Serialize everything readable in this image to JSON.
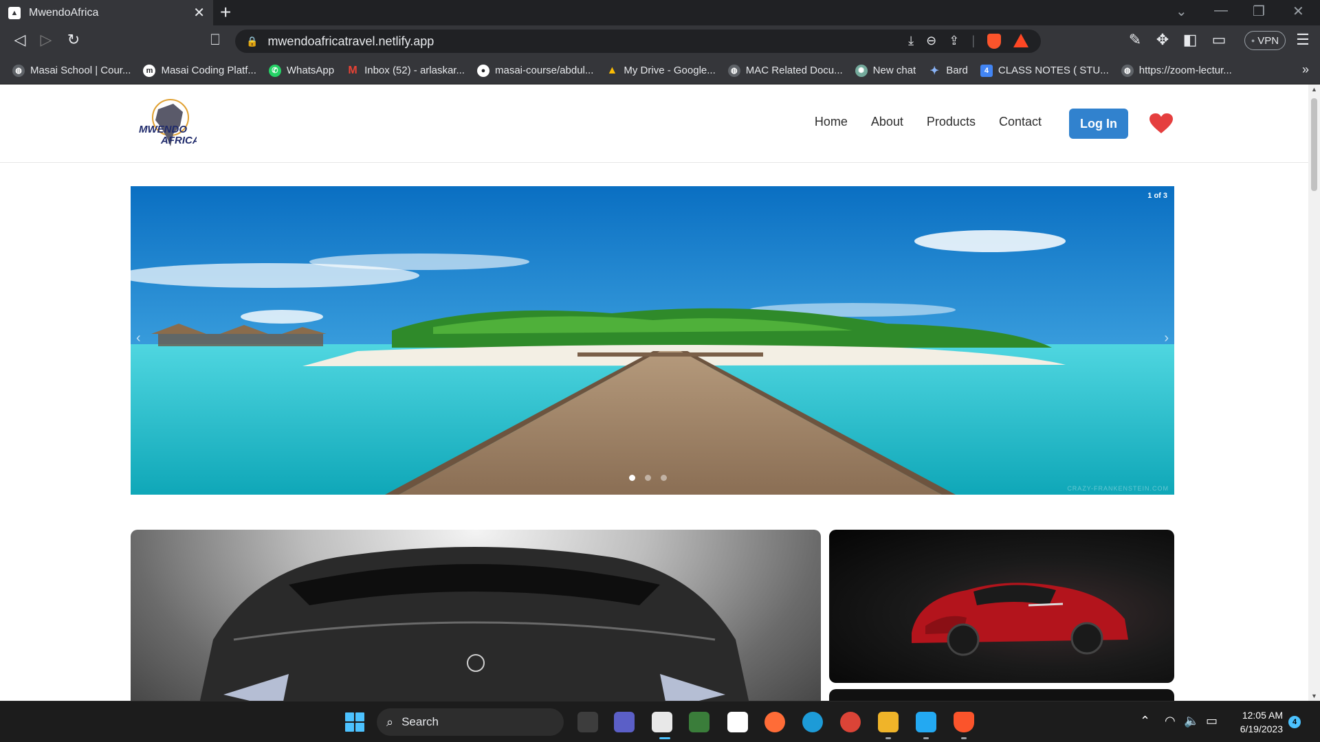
{
  "browser": {
    "tab": {
      "title": "MwendoAfrica",
      "favicon_icon": "page-icon"
    },
    "url": "mwendoafricatravel.netlify.app",
    "vpn_label": "VPN",
    "bookmarks": [
      {
        "label": "Masai School | Cour...",
        "icon": "globe-icon",
        "color": "#5f6368"
      },
      {
        "label": "Masai Coding Platf...",
        "icon": "m-icon",
        "color": "#202124"
      },
      {
        "label": "WhatsApp",
        "icon": "whatsapp-icon",
        "color": "#25d366"
      },
      {
        "label": "Inbox (52) - arlaskar...",
        "icon": "gmail-icon",
        "color": "#ea4335"
      },
      {
        "label": "masai-course/abdul...",
        "icon": "github-icon",
        "color": "#202124"
      },
      {
        "label": "My Drive - Google...",
        "icon": "drive-icon",
        "color": "#fbbc04"
      },
      {
        "label": "MAC Related Docu...",
        "icon": "globe-icon",
        "color": "#5f6368"
      },
      {
        "label": "New chat",
        "icon": "chatgpt-icon",
        "color": "#74aa9c"
      },
      {
        "label": "Bard",
        "icon": "bard-icon",
        "color": "#4285f4"
      },
      {
        "label": "CLASS NOTES ( STU...",
        "icon": "doc-4-icon",
        "color": "#4285f4"
      },
      {
        "label": "https://zoom-lectur...",
        "icon": "globe-icon",
        "color": "#5f6368"
      }
    ],
    "bookmark_4_badge": "4",
    "bookmarks_more": "»"
  },
  "site": {
    "logo_text_1": "MWENDO",
    "logo_text_2": "AFRICA",
    "nav": {
      "home": "Home",
      "about": "About",
      "products": "Products",
      "contact": "Contact"
    },
    "login_label": "Log In",
    "carousel": {
      "counter": "1 of 3",
      "active_index": 0,
      "slide_count": 3,
      "watermark": "CRAZY-FRANKENSTEIN.COM"
    }
  },
  "taskbar": {
    "search_label": "Search",
    "time": "12:05 AM",
    "date": "6/19/2023",
    "notifications": "4"
  },
  "colors": {
    "accent": "#3182ce",
    "heart": "#e53e3e",
    "chrome_dark": "#202124",
    "chrome": "#35363a"
  }
}
